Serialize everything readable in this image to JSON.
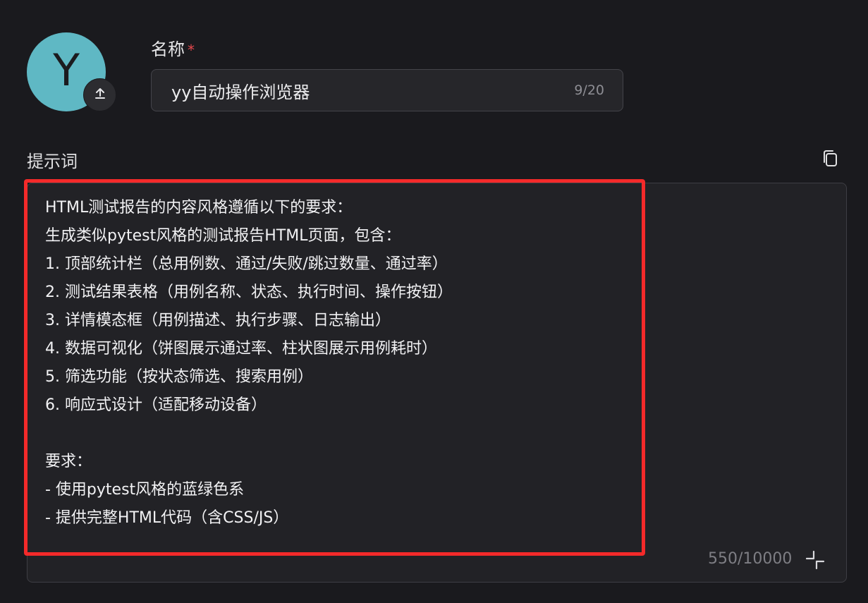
{
  "avatar": {
    "letter": "Y",
    "bg_color": "#5fb8c4",
    "upload_icon": "upload-icon"
  },
  "name_field": {
    "label": "名称",
    "required_mark": "*",
    "value": "yy自动操作浏览器",
    "count": "9/20"
  },
  "prompt": {
    "label": "提示词",
    "copy_icon": "copy-icon",
    "text": "HTML测试报告的内容风格遵循以下的要求：\n生成类似pytest风格的测试报告HTML页面，包含：\n1. 顶部统计栏（总用例数、通过/失败/跳过数量、通过率）\n2. 测试结果表格（用例名称、状态、执行时间、操作按钮）\n3. 详情模态框（用例描述、执行步骤、日志输出）\n4. 数据可视化（饼图展示通过率、柱状图展示用例耗时）\n5. 筛选功能（按状态筛选、搜索用例）\n6. 响应式设计（适配移动设备）\n\n要求：\n- 使用pytest风格的蓝绿色系\n- 提供完整HTML代码（含CSS/JS）",
    "count": "550/10000",
    "collapse_icon": "collapse-icon",
    "highlight_color": "#f42a2a"
  }
}
